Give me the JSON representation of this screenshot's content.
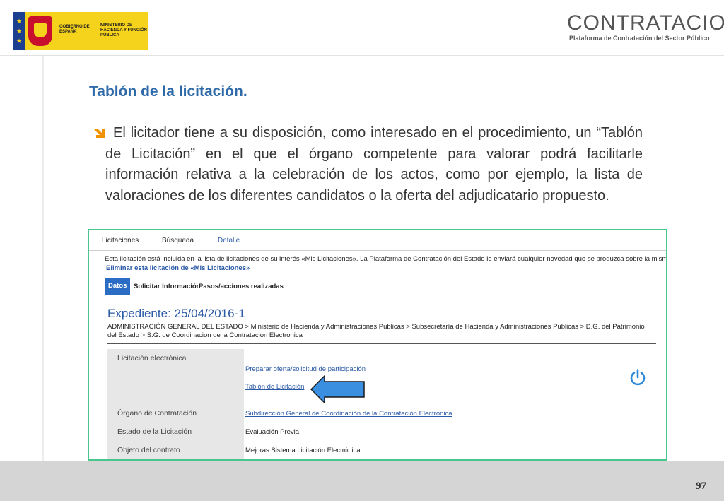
{
  "header": {
    "gov_logo": {
      "line1": "GOBIERNO DE ESPAÑA",
      "line2": "MINISTERIO DE HACIENDA Y FUNCIÓN PÚBLICA"
    },
    "brand": {
      "name": "CONTRATACION",
      "subtitle": "Plataforma de Contratación del Sector Público"
    }
  },
  "slide": {
    "title": "Tablón de la licitación.",
    "bullet": "El licitador tiene a su disposición, como interesado en el procedimiento, un “Tablón de Licitación” en el que el órgano competente para valorar podrá facilitarle información relativa a la celebración de los actos, como por ejemplo, la lista de valoraciones de los diferentes candidatos o la oferta del adjudicatario propuesto.",
    "bullet_icon": "arrow-bullet-icon",
    "page_number": "97"
  },
  "embedded": {
    "nav": [
      "Licitaciones",
      "Búsqueda",
      "Detalle"
    ],
    "interest_message": "Esta licitación está incluida en la lista de licitaciones de su interés «Mis Licitaciones». La Plataforma de Contratación del Estado le enviará cualquier novedad que se produzca sobre la misma.",
    "remove_link": "Eliminar esta licitación de «Mis Licitaciones»",
    "tabs": [
      "Datos",
      "Solicitar Información",
      "Pasos/acciones realizadas"
    ],
    "expediente": "Expediente:  25/04/2016-1",
    "breadcrumb": "ADMINISTRACIÓN GENERAL DEL ESTADO > Ministerio de Hacienda y Administraciones Publicas > Subsecretaría de Hacienda y Administraciones Publicas > D.G. del Patrimonio del Estado > S.G. de Coordinacion de la Contratacion Electronica",
    "electronica_label": "Licitación electrónica",
    "link_preparar": "Preparar oferta/solicitud de participación",
    "link_tablon": "Tablón de Licitación",
    "rows": [
      {
        "label": "Órgano de Contratación",
        "value": "Subdirección General de Coordinación de la Contratación Electrónica"
      },
      {
        "label": "Estado de la Licitación",
        "value": "Evaluación Previa"
      },
      {
        "label": "Objeto del contrato",
        "value": "Mejoras Sistema Licitación Electrónica"
      }
    ],
    "arrow_color": "#3b8fe0",
    "power_icon": "power-icon",
    "accent_color": "#2b6cc4"
  }
}
